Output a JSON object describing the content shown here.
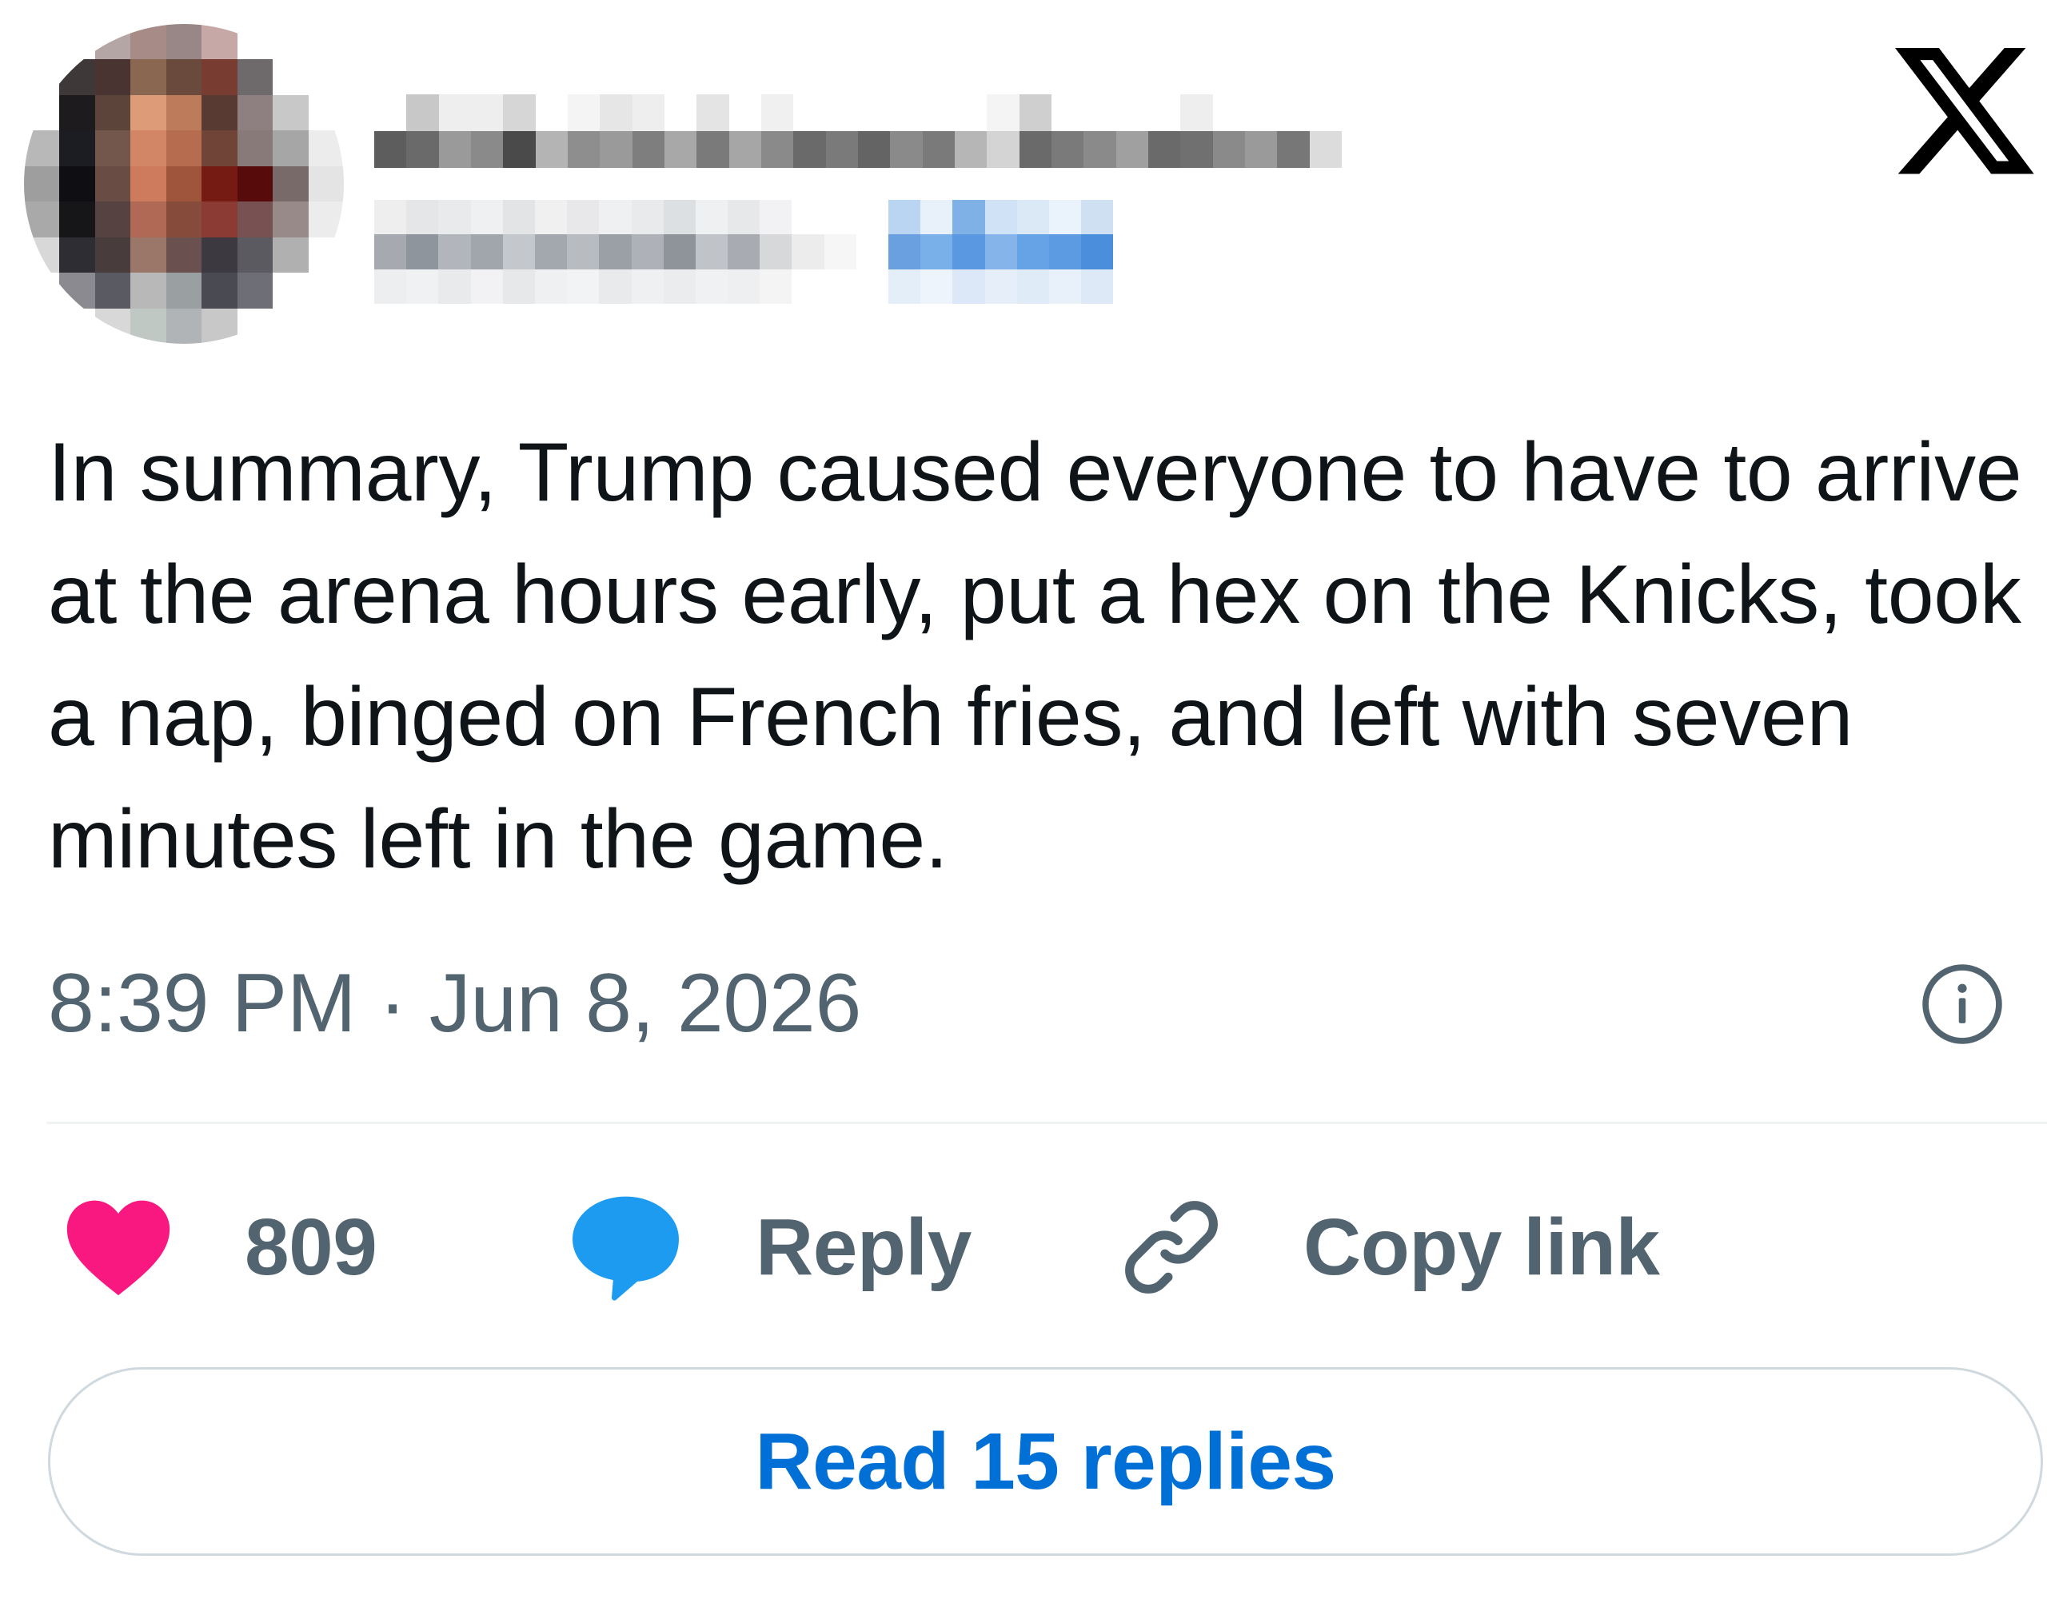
{
  "header": {
    "logo_icon": "x-logo-icon",
    "avatar_colors": [
      [
        "#ffffff",
        "#ffffff",
        "#b5a6a4",
        "#a88b87",
        "#9a8686",
        "#c7a9a7",
        "#ffffff",
        "#ffffff",
        "#ffffff"
      ],
      [
        "#ffffff",
        "#3e3838",
        "#4a3431",
        "#8c6750",
        "#6a4a3c",
        "#7c3b2f",
        "#6e6a6b",
        "#ffffff",
        "#ffffff"
      ],
      [
        "#ffffff",
        "#1d1b1d",
        "#5e4439",
        "#e19a75",
        "#c07a5a",
        "#5a3a31",
        "#8f7f80",
        "#c8c8c8",
        "#ffffff"
      ],
      [
        "#b8b8b8",
        "#1c1d22",
        "#75574b",
        "#d58564",
        "#b96c4d",
        "#724435",
        "#8a7a7a",
        "#a6a6a6",
        "#ececec"
      ],
      [
        "#9e9e9e",
        "#0f0f13",
        "#6a4d44",
        "#d07a5a",
        "#a2533a",
        "#7a1a12",
        "#5a0a0a",
        "#7a6a6a",
        "#e4e4e4"
      ],
      [
        "#a9a9a9",
        "#161619",
        "#584242",
        "#b26853",
        "#8a4a3a",
        "#8e3a33",
        "#7a5252",
        "#9a8a8a",
        "#ececec"
      ],
      [
        "#d8d8d8",
        "#2d2d33",
        "#4a3c3c",
        "#9c7767",
        "#6c5050",
        "#3c3a40",
        "#5a5a60",
        "#b0b0b0",
        "#ffffff"
      ],
      [
        "#ffffff",
        "#8a8a90",
        "#5a5a62",
        "#b8b8b8",
        "#9aa0a2",
        "#4a4a52",
        "#6e6e76",
        "#ffffff",
        "#ffffff"
      ],
      [
        "#ffffff",
        "#ffffff",
        "#d8d8d8",
        "#c0c8c4",
        "#b0b4b6",
        "#c8c8c8",
        "#ffffff",
        "#ffffff",
        "#ffffff"
      ]
    ],
    "name_colors": [
      [
        "#ffffff",
        "#c8c8c8",
        "#eeeeee",
        "#eeeeee",
        "#d6d6d6",
        "#ffffff",
        "#f4f4f4",
        "#e6e6e6",
        "#eeeeee",
        "#ffffff",
        "#e4e4e4",
        "#ffffff",
        "#f0f0f0",
        "#ffffff",
        "#ffffff",
        "#ffffff",
        "#ffffff",
        "#ffffff",
        "#ffffff",
        "#f4f4f4",
        "#cfcfcf",
        "#ffffff",
        "#ffffff",
        "#ffffff",
        "#ffffff",
        "#eeeeee",
        "#ffffff",
        "#ffffff",
        "#ffffff",
        "#ffffff"
      ],
      [
        "#5d5d5d",
        "#6a6a6a",
        "#9a9a9a",
        "#8a8a8a",
        "#4a4a4a",
        "#b4b4b4",
        "#8e8e8e",
        "#9a9a9a",
        "#7e7e7e",
        "#a8a8a8",
        "#7a7a7a",
        "#a6a6a6",
        "#8a8a8a",
        "#6a6a6a",
        "#7a7a7a",
        "#646464",
        "#8a8a8a",
        "#7a7a7a",
        "#b6b6b6",
        "#d4d4d4",
        "#6a6a6a",
        "#7a7a7a",
        "#8a8a8a",
        "#a0a0a0",
        "#6a6a6a",
        "#707070",
        "#8a8a8a",
        "#9a9a9a",
        "#777777",
        "#dcdcdc"
      ]
    ],
    "handle_colors": [
      [
        "#eeeeee",
        "#e4e6e8",
        "#e8eaec",
        "#eef0f2",
        "#e2e4e6",
        "#f0f0f0",
        "#e8e8ea",
        "#eef0f2",
        "#e8eaec",
        "#dde0e2",
        "#eef0f2",
        "#e6e8ea",
        "#f2f2f4",
        "#ffffff",
        "#ffffff",
        "#ffffff",
        "#b9d5f2",
        "#e8f0fa",
        "#7fb0e6",
        "#cfe2f6",
        "#dbe8f6",
        "#eaf2fb",
        "#cfe0f2",
        "#ffffff",
        "#ffffff",
        "#ffffff"
      ],
      [
        "#a6aab0",
        "#8e959c",
        "#b2b6bc",
        "#a0a6ac",
        "#c4c8cc",
        "#a2a8ae",
        "#b8bcc0",
        "#9aa0a6",
        "#aeb2b8",
        "#8e949a",
        "#c0c4c8",
        "#a8acb2",
        "#d6d8da",
        "#ececec",
        "#f6f6f6",
        "#ffffff",
        "#6aa0e0",
        "#7ab0ea",
        "#5a98e2",
        "#84b4ea",
        "#66a2e6",
        "#5c9ae2",
        "#4a8edc",
        "#ffffff",
        "#ffffff",
        "#ffffff"
      ],
      [
        "#eceeef",
        "#f0f1f2",
        "#e8eaec",
        "#f2f2f4",
        "#e6e8ea",
        "#eef0f1",
        "#f2f3f4",
        "#e8eaec",
        "#eef0f1",
        "#eaeced",
        "#f0f1f2",
        "#eeeff0",
        "#f4f4f5",
        "#ffffff",
        "#ffffff",
        "#ffffff",
        "#e4eef9",
        "#eef4fb",
        "#dce8f7",
        "#e6eef9",
        "#e0ebf8",
        "#e8f0fa",
        "#dde9f7",
        "#ffffff",
        "#ffffff",
        "#ffffff"
      ]
    ]
  },
  "tweet": {
    "text": "In summary, Trump caused everyone to have to arrive at the arena hours early, put a hex on the Knicks, took a nap, binged on French fries, and left with seven minutes left in the game.",
    "timestamp": "8:39 PM · Jun 8, 2026",
    "info_icon": "info-icon"
  },
  "actions": {
    "like": {
      "icon": "heart-icon",
      "count": "809",
      "color": "#f91880"
    },
    "reply": {
      "icon": "speech-bubble-icon",
      "label": "Reply",
      "color": "#1d9bf0"
    },
    "copy": {
      "icon": "link-icon",
      "label": "Copy link"
    }
  },
  "read_replies": {
    "label": "Read 15 replies",
    "color": "#006fd6"
  }
}
